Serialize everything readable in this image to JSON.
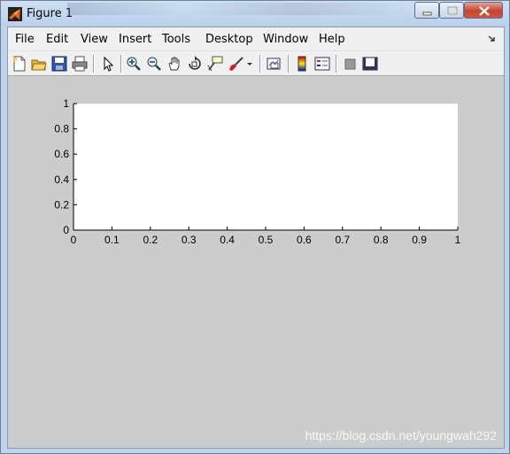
{
  "window": {
    "title": "Figure 1"
  },
  "menu": {
    "items": [
      "File",
      "Edit",
      "View",
      "Insert",
      "Tools",
      "Desktop",
      "Window",
      "Help"
    ]
  },
  "toolbar": {
    "icons": [
      "new-figure-icon",
      "open-file-icon",
      "save-icon",
      "print-icon",
      "edit-plot-icon",
      "zoom-in-icon",
      "zoom-out-icon",
      "pan-icon",
      "rotate-3d-icon",
      "data-cursor-icon",
      "brush-icon",
      "link-plot-icon",
      "insert-colorbar-icon",
      "insert-legend-icon",
      "hide-plot-tools-icon",
      "show-plot-tools-icon"
    ]
  },
  "chart_data": {
    "type": "line",
    "title": "",
    "xlabel": "",
    "ylabel": "",
    "xlim": [
      0,
      1
    ],
    "ylim": [
      0,
      1
    ],
    "x_ticks": [
      "0",
      "0.1",
      "0.2",
      "0.3",
      "0.4",
      "0.5",
      "0.6",
      "0.7",
      "0.8",
      "0.9",
      "1"
    ],
    "y_ticks": [
      "0",
      "0.2",
      "0.4",
      "0.6",
      "0.8",
      "1"
    ],
    "series": [],
    "grid": false
  },
  "watermark": "https://blog.csdn.net/youngwah292"
}
